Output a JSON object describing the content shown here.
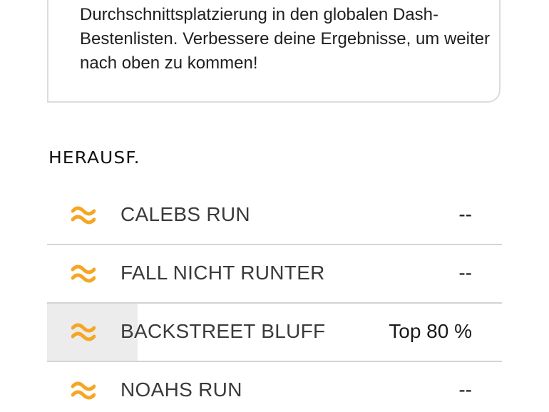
{
  "info": {
    "text": "Durchschnittsplatzierung in den globalen Dash-Bestenlisten. Verbessere deine Ergebnisse, um weiter nach oben zu kommen!"
  },
  "challenges": {
    "title": "HERAUSF.",
    "icon": "dash-wave-icon",
    "accent_color": "#F5A623",
    "items": [
      {
        "name": "CALEBS RUN",
        "value": "--"
      },
      {
        "name": "FALL NICHT RUNTER",
        "value": "--"
      },
      {
        "name": "BACKSTREET BLUFF",
        "value": "Top 80 %"
      },
      {
        "name": "NOAHS RUN",
        "value": "--"
      }
    ]
  }
}
